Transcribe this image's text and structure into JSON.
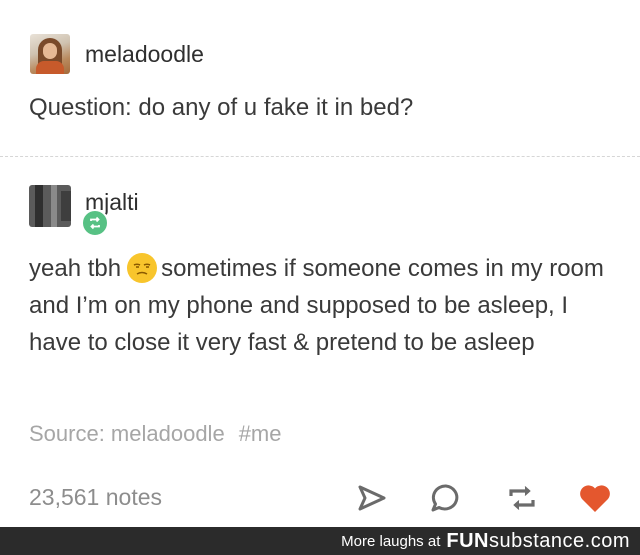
{
  "original_post": {
    "username": "meladoodle",
    "text": "Question: do any of u fake it in bed?"
  },
  "reply": {
    "username": "mjalti",
    "text_before_emoji": "yeah tbh",
    "emoji": "unamused-face",
    "text_after_emoji": "sometimes if someone comes in my room and I’m on my phone and supposed to be asleep, I have to close it very fast & pretend to be asleep"
  },
  "source": {
    "label": "Source: meladoodle",
    "tag": "#me"
  },
  "footer": {
    "notes": "23,561 notes",
    "icons": [
      "share-icon",
      "reply-icon",
      "reblog-icon",
      "like-icon"
    ],
    "like_color": "#e4572e"
  },
  "watermark": {
    "text": "More laughs at",
    "brand_bold": "FUN",
    "brand_light": "substance",
    "brand_suffix": ".com"
  },
  "colors": {
    "reblog_badge": "#57c184",
    "text": "#3a3a3a",
    "muted": "#a6a6a6"
  }
}
